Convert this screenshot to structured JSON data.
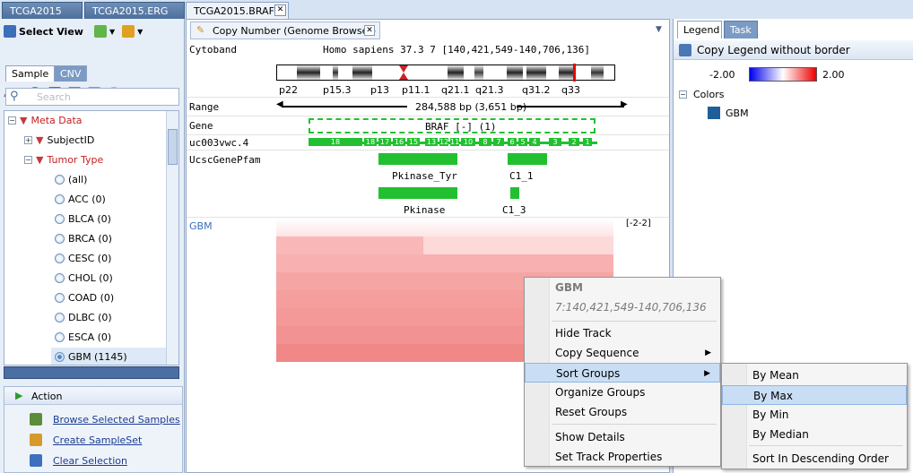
{
  "doc_tabs": [
    "TCGA2015",
    "TCGA2015.ERG",
    "TCGA2015.BRAF"
  ],
  "close_glyph": "✕",
  "left": {
    "select_view": "Select View",
    "tabs": [
      "Sample",
      "CNV"
    ],
    "search_placeholder": "Search",
    "tree": {
      "meta": "Meta Data",
      "subject": "SubjectID",
      "tumor": "Tumor Type",
      "options": [
        "(all)",
        "ACC (0)",
        "BLCA (0)",
        "BRCA (0)",
        "CESC (0)",
        "CHOL (0)",
        "COAD (0)",
        "DLBC (0)",
        "ESCA (0)",
        "GBM (1145)"
      ]
    },
    "action": {
      "title": "Action",
      "links": [
        "Browse Selected Samples",
        "Create SampleSet",
        "Clear Selection"
      ]
    }
  },
  "center": {
    "tab": "Copy Number (Genome Browser)",
    "cytoband_label": "Cytoband",
    "cytoband_title": "Homo sapiens 37.3 7 [140,421,549-140,706,136]",
    "bands": [
      "p22",
      "p15.3",
      "p13",
      "p11.1",
      "q21.1",
      "q21.3",
      "q31.2",
      "q33"
    ],
    "range_label": "Range",
    "range_value": "284,588 bp (3,651 bp)",
    "gene_label": "Gene",
    "gene_value": "BRAF [-] (1)",
    "transcript_label": "uc003vwc.4",
    "exons": [
      "18",
      "18",
      "17",
      "16",
      "15",
      "13",
      "12",
      "11",
      "10",
      "8",
      "7",
      "6",
      "5",
      "4",
      "3",
      "2",
      "1"
    ],
    "pfam_label": "UcscGenePfam",
    "pfam": [
      "Pkinase_Tyr",
      "C1_1",
      "Pkinase",
      "C1_3"
    ],
    "gbm_label": "GBM",
    "gbm_range": "[-2-2]"
  },
  "right": {
    "tabs": [
      "Legend",
      "Task"
    ],
    "copy_legend": "Copy Legend  without border",
    "scale_min": "-2.00",
    "scale_max": "2.00",
    "colors": "Colors",
    "group": "GBM",
    "group_color": "#1f5f99"
  },
  "context_menu": {
    "title": "GBM",
    "subtitle": "7:140,421,549-140,706,136",
    "items": [
      "Hide Track",
      "Copy Sequence",
      "Sort Groups",
      "Organize Groups",
      "Reset Groups",
      "Show Details",
      "Set Track Properties"
    ]
  },
  "submenu": {
    "items": [
      "By Mean",
      "By Max",
      "By Min",
      "By Median",
      "Sort In Descending Order"
    ]
  }
}
